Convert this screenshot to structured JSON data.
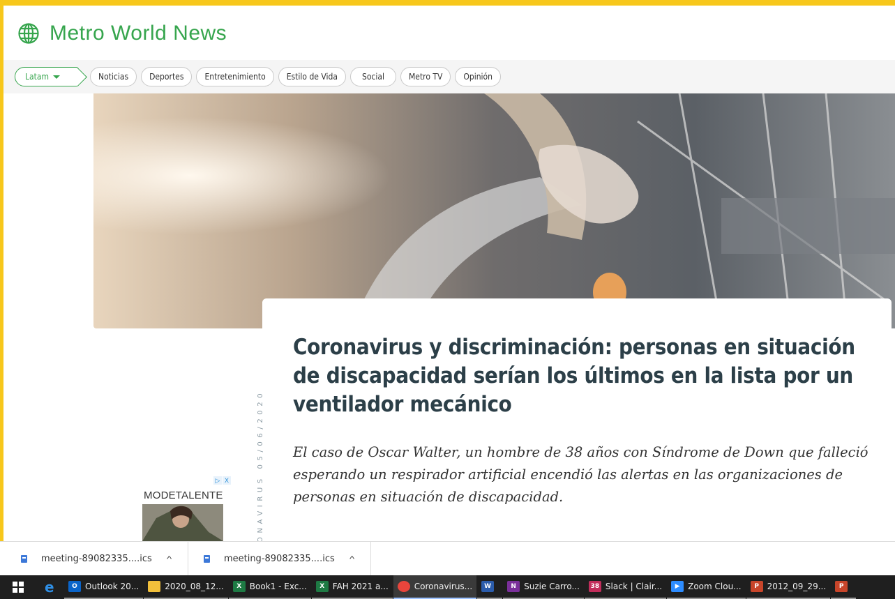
{
  "site": {
    "name": "Metro World News",
    "edition": "Latam",
    "nav": [
      "Noticias",
      "Deportes",
      "Entretenimiento",
      "Estilo de Vida",
      "Social",
      "Metro TV",
      "Opinión"
    ]
  },
  "article": {
    "headline": "Coronavirus y discriminación: personas en situación de discapacidad serían los últimos en la lista por un ventilador mecánico",
    "lead": "El caso de Oscar Walter, un hombre de 38 años con Síndrome de Down que falleció esperando un respirador artificial encendió las alertas en las organizaciones de personas en situación de discapacidad.",
    "dateline": "ONAVIRUS 05/06/2020"
  },
  "ad": {
    "text": "MODETALENTE",
    "badge": [
      "▷",
      "X"
    ]
  },
  "downloads": [
    {
      "name": "meeting-89082335....ics"
    },
    {
      "name": "meeting-89082335....ics"
    }
  ],
  "taskbar": {
    "items": [
      {
        "label": "Outlook 20...",
        "glyph": "O",
        "color": "#0a64c9"
      },
      {
        "label": "2020_08_12...",
        "glyph": "",
        "color": "#f2c03b"
      },
      {
        "label": "Book1 - Exc...",
        "glyph": "X",
        "color": "#1e7a44"
      },
      {
        "label": "FAH 2021 a...",
        "glyph": "X",
        "color": "#1e7a44"
      },
      {
        "label": "Coronavirus...",
        "glyph": "",
        "color": "#e8453c"
      },
      {
        "label": "",
        "glyph": "W",
        "color": "#2b5cab"
      },
      {
        "label": "Suzie Carro...",
        "glyph": "N",
        "color": "#7a2f9a"
      },
      {
        "label": "Slack | Clair...",
        "glyph": "38",
        "color": "#c22d5b"
      },
      {
        "label": "Zoom Clou...",
        "glyph": "▶",
        "color": "#2d8cff"
      },
      {
        "label": "2012_09_29...",
        "glyph": "P",
        "color": "#c8452a"
      },
      {
        "label": "",
        "glyph": "P",
        "color": "#c8452a"
      }
    ],
    "active_index": 4
  }
}
